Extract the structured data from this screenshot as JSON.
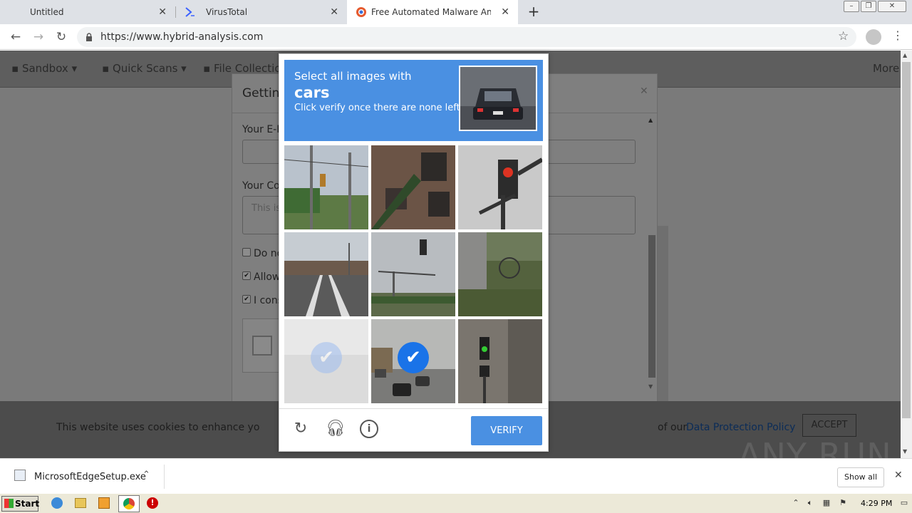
{
  "browser": {
    "tabs": [
      {
        "title": "Untitled"
      },
      {
        "title": "VirusTotal"
      },
      {
        "title": "Free Automated Malware Analysis Se"
      }
    ],
    "url": "https://www.hybrid-analysis.com"
  },
  "site": {
    "nav": [
      "Sandbox",
      "Quick Scans",
      "File Collection",
      "More"
    ]
  },
  "modal": {
    "title": "Getting",
    "email_label": "Your E-M",
    "comment_label": "Your Con",
    "comment_placeholder": "This is",
    "checks": [
      {
        "label": "Do no",
        "checked": false
      },
      {
        "label": "Allow",
        "checked": true
      },
      {
        "label": "I cons",
        "checked": true
      }
    ]
  },
  "captcha": {
    "line1": "Select all images with",
    "target": "cars",
    "line3": "Click verify once there are none left",
    "verify_label": "VERIFY",
    "tiles": [
      {
        "scene": "traffic light pole by road",
        "selected": false
      },
      {
        "scene": "building fire escape",
        "selected": false
      },
      {
        "scene": "traffic light close-up",
        "selected": false
      },
      {
        "scene": "highway overpass",
        "selected": false
      },
      {
        "scene": "traffic lights over road",
        "selected": false
      },
      {
        "scene": "street with trees",
        "selected": false
      },
      {
        "scene": "road (fading)",
        "selected": true
      },
      {
        "scene": "road with cars",
        "selected": true
      },
      {
        "scene": "pedestrian signal",
        "selected": false
      }
    ]
  },
  "cookie": {
    "text": "This website uses cookies to enhance yo",
    "text2": "of our",
    "link": "Data Protection Policy",
    "accept": "ACCEPT"
  },
  "watermark": "ANY RUN",
  "download": {
    "filename": "MicrosoftEdgeSetup.exe",
    "show_all": "Show all"
  },
  "taskbar": {
    "start": "Start",
    "clock": "4:29 PM"
  }
}
